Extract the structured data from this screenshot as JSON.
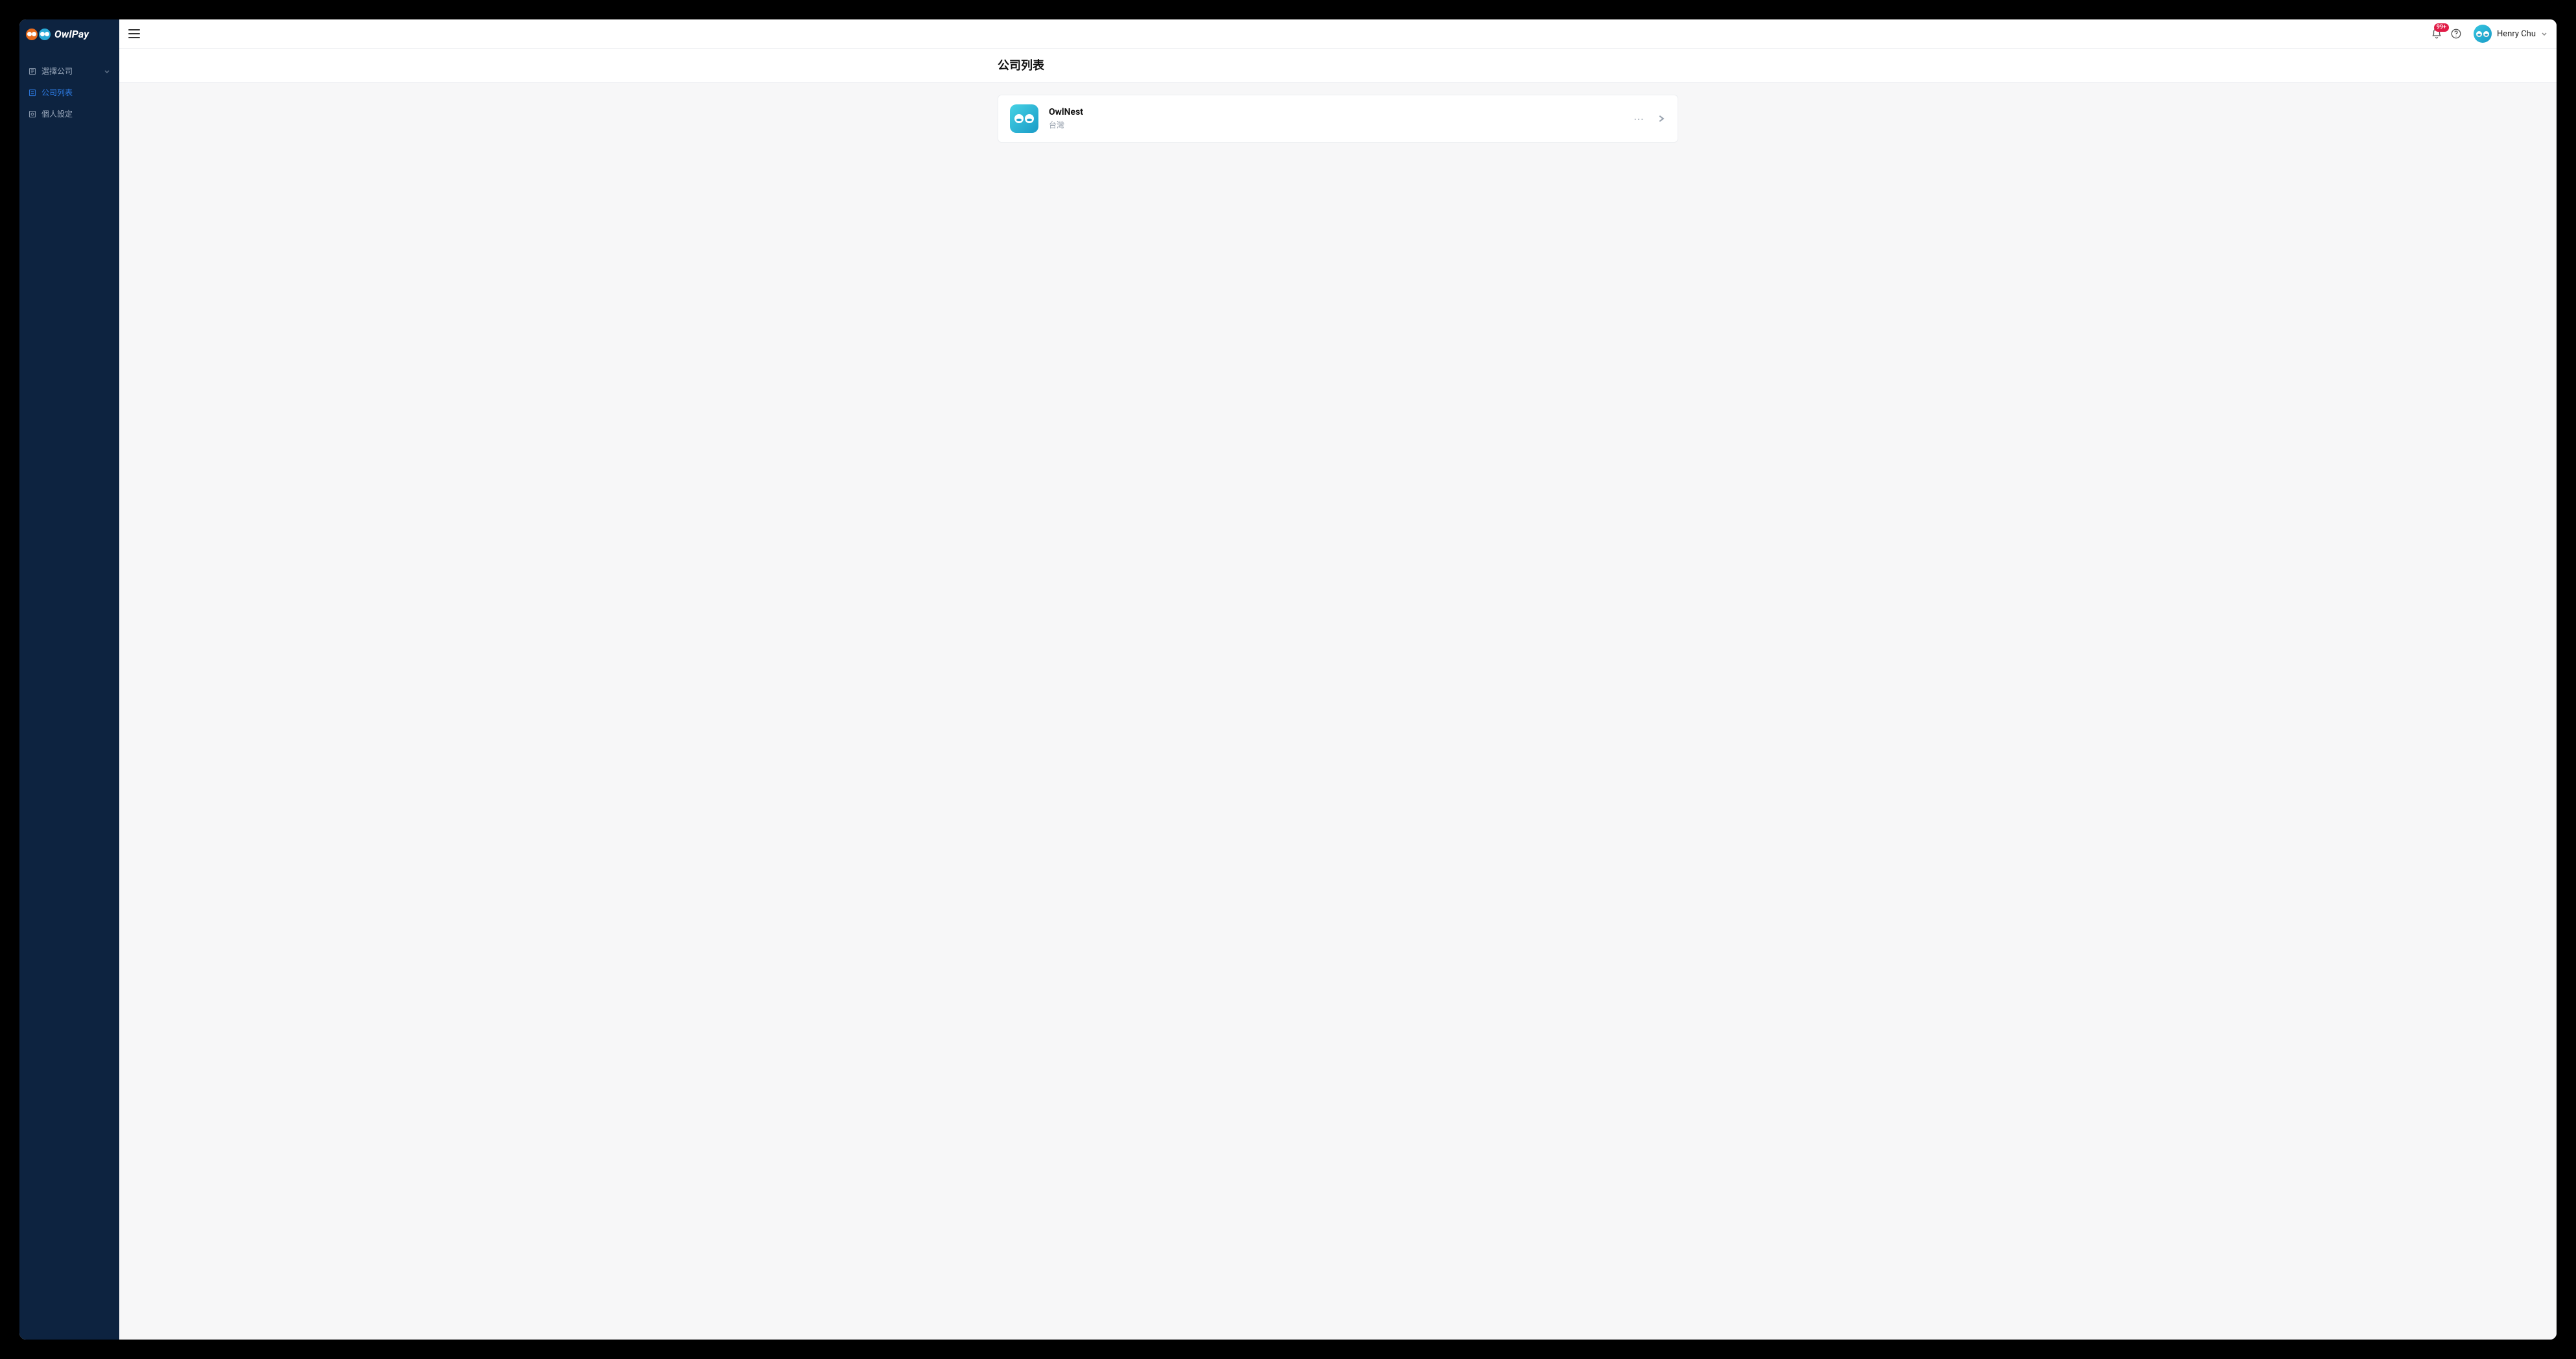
{
  "brand": {
    "name": "OwlPay"
  },
  "sidebar": {
    "items": [
      {
        "label": "選擇公司",
        "icon": "company-select-icon",
        "expandable": true
      },
      {
        "label": "公司列表",
        "icon": "list-icon",
        "active": true
      },
      {
        "label": "個人設定",
        "icon": "settings-icon"
      }
    ]
  },
  "header": {
    "notification_badge": "99+",
    "username": "Henry Chu"
  },
  "page": {
    "title": "公司列表"
  },
  "companies": [
    {
      "name": "OwlNest",
      "region": "台灣"
    }
  ]
}
